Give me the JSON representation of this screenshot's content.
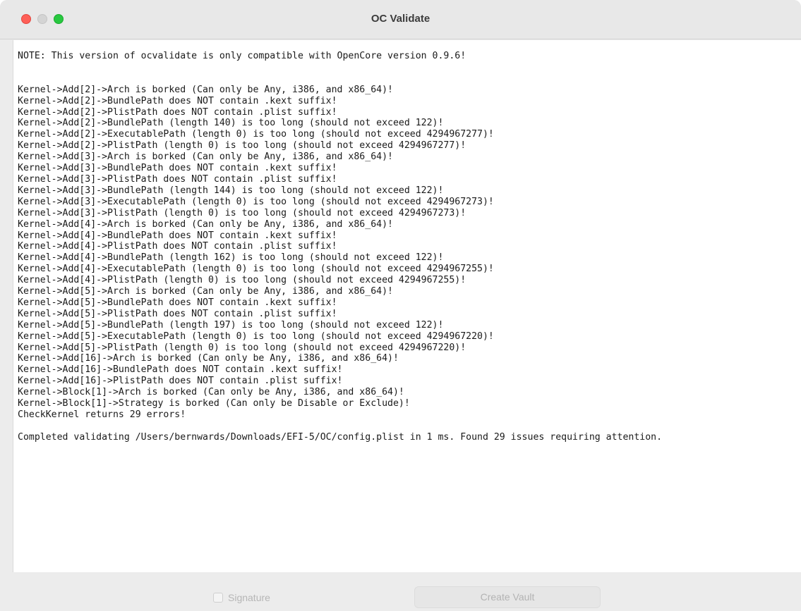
{
  "window": {
    "title": "OC Validate"
  },
  "output": {
    "text": "NOTE: This version of ocvalidate is only compatible with OpenCore version 0.9.6!\n\n\nKernel->Add[2]->Arch is borked (Can only be Any, i386, and x86_64)!\nKernel->Add[2]->BundlePath does NOT contain .kext suffix!\nKernel->Add[2]->PlistPath does NOT contain .plist suffix!\nKernel->Add[2]->BundlePath (length 140) is too long (should not exceed 122)!\nKernel->Add[2]->ExecutablePath (length 0) is too long (should not exceed 4294967277)!\nKernel->Add[2]->PlistPath (length 0) is too long (should not exceed 4294967277)!\nKernel->Add[3]->Arch is borked (Can only be Any, i386, and x86_64)!\nKernel->Add[3]->BundlePath does NOT contain .kext suffix!\nKernel->Add[3]->PlistPath does NOT contain .plist suffix!\nKernel->Add[3]->BundlePath (length 144) is too long (should not exceed 122)!\nKernel->Add[3]->ExecutablePath (length 0) is too long (should not exceed 4294967273)!\nKernel->Add[3]->PlistPath (length 0) is too long (should not exceed 4294967273)!\nKernel->Add[4]->Arch is borked (Can only be Any, i386, and x86_64)!\nKernel->Add[4]->BundlePath does NOT contain .kext suffix!\nKernel->Add[4]->PlistPath does NOT contain .plist suffix!\nKernel->Add[4]->BundlePath (length 162) is too long (should not exceed 122)!\nKernel->Add[4]->ExecutablePath (length 0) is too long (should not exceed 4294967255)!\nKernel->Add[4]->PlistPath (length 0) is too long (should not exceed 4294967255)!\nKernel->Add[5]->Arch is borked (Can only be Any, i386, and x86_64)!\nKernel->Add[5]->BundlePath does NOT contain .kext suffix!\nKernel->Add[5]->PlistPath does NOT contain .plist suffix!\nKernel->Add[5]->BundlePath (length 197) is too long (should not exceed 122)!\nKernel->Add[5]->ExecutablePath (length 0) is too long (should not exceed 4294967220)!\nKernel->Add[5]->PlistPath (length 0) is too long (should not exceed 4294967220)!\nKernel->Add[16]->Arch is borked (Can only be Any, i386, and x86_64)!\nKernel->Add[16]->BundlePath does NOT contain .kext suffix!\nKernel->Add[16]->PlistPath does NOT contain .plist suffix!\nKernel->Block[1]->Arch is borked (Can only be Any, i386, and x86_64)!\nKernel->Block[1]->Strategy is borked (Can only be Disable or Exclude)!\nCheckKernel returns 29 errors!\n\nCompleted validating /Users/bernwards/Downloads/EFI-5/OC/config.plist in 1 ms. Found 29 issues requiring attention."
  },
  "footer": {
    "signature_label": "Signature",
    "signature_checked": false,
    "signature_enabled": false,
    "create_vault_label": "Create Vault",
    "create_vault_enabled": false
  },
  "colors": {
    "close": "#fe5f57",
    "minimize": "#d4d4d4",
    "zoom": "#28c840"
  }
}
